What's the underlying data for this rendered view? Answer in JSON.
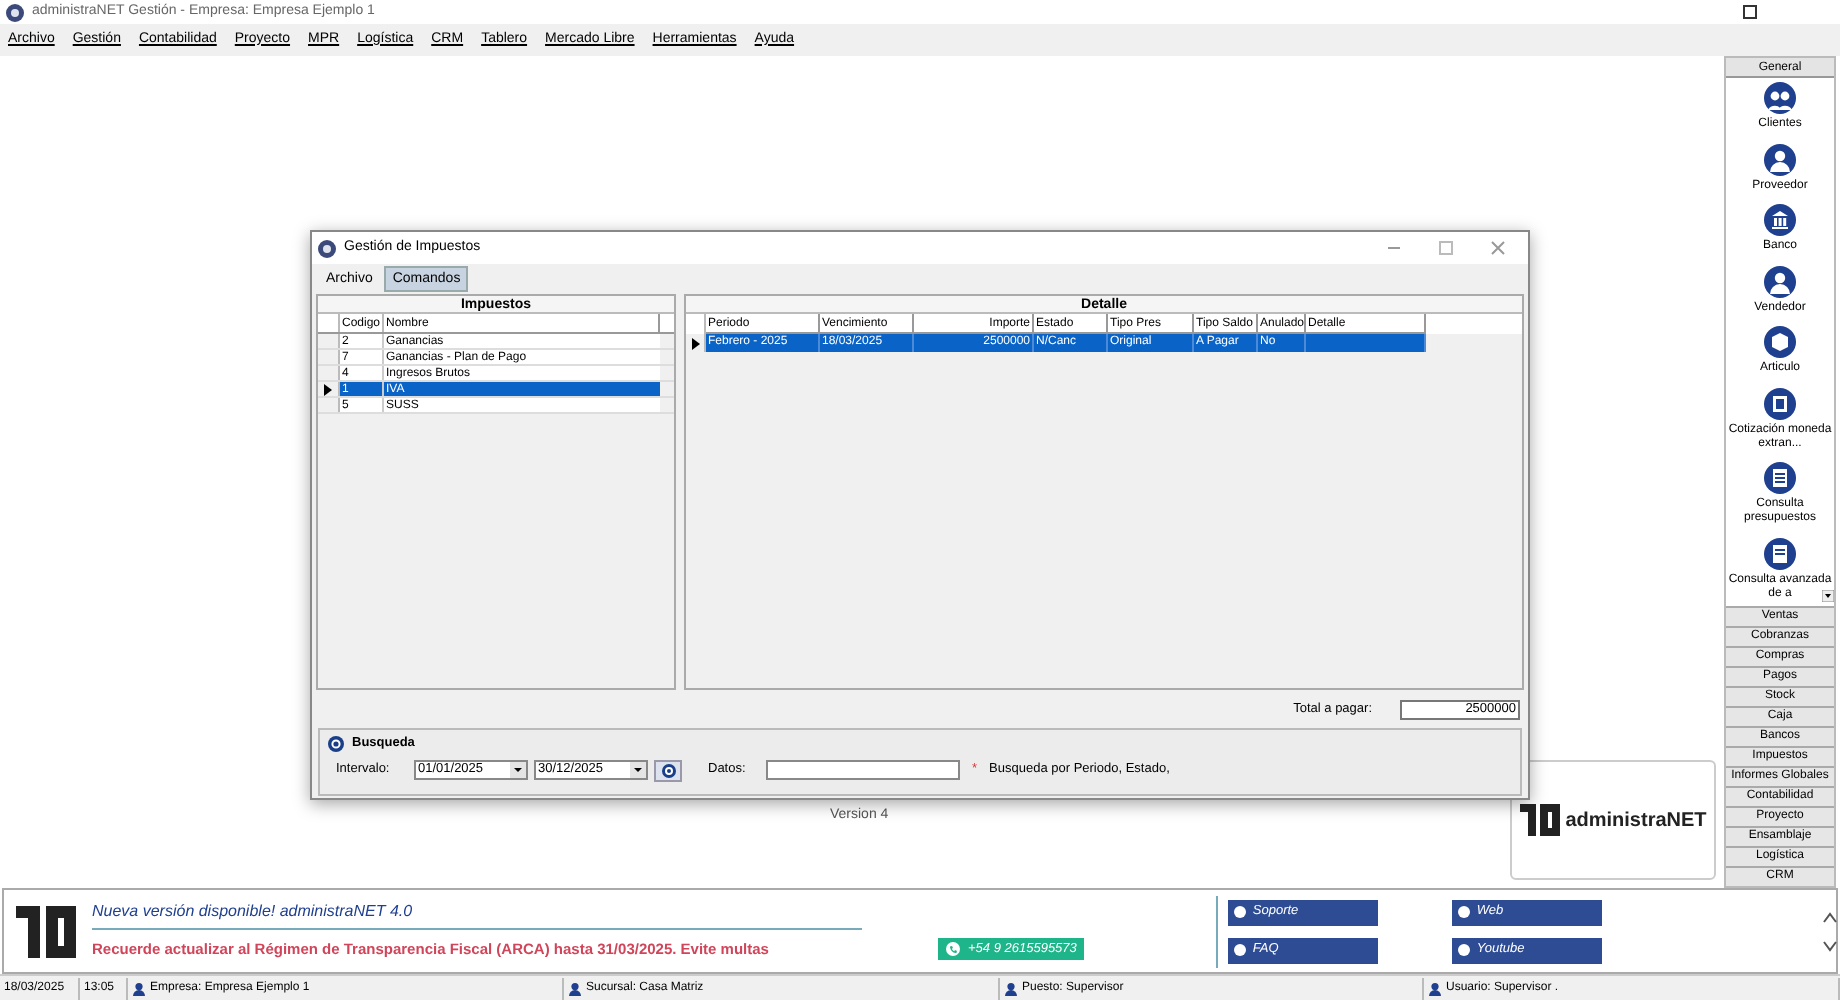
{
  "window": {
    "title": "administraNET Gestión - Empresa: Empresa Ejemplo 1"
  },
  "menu": [
    {
      "label": "Archivo"
    },
    {
      "label": "Gestión"
    },
    {
      "label": "Contabilidad"
    },
    {
      "label": "Proyecto"
    },
    {
      "label": "MPR"
    },
    {
      "label": "Logística"
    },
    {
      "label": "CRM"
    },
    {
      "label": "Tablero"
    },
    {
      "label": "Mercado Libre"
    },
    {
      "label": "Herramientas"
    },
    {
      "label": "Ayuda"
    }
  ],
  "dialog": {
    "title": "Gestión de Impuestos",
    "menu": [
      {
        "label": "Archivo",
        "selected": false
      },
      {
        "label": "Comandos",
        "selected": true
      }
    ],
    "taxes": {
      "title": "Impuestos",
      "columns": [
        "Codigo",
        "Nombre"
      ],
      "rows": [
        {
          "code": "2",
          "name": "Ganancias",
          "selected": false
        },
        {
          "code": "7",
          "name": "Ganancias - Plan de Pago",
          "selected": false
        },
        {
          "code": "4",
          "name": "Ingresos Brutos",
          "selected": false
        },
        {
          "code": "1",
          "name": "IVA",
          "selected": true
        },
        {
          "code": "5",
          "name": "SUSS",
          "selected": false
        }
      ]
    },
    "detail": {
      "title": "Detalle",
      "columns": [
        "Periodo",
        "Vencimiento",
        "Importe",
        "Estado",
        "Tipo Pres",
        "Tipo Saldo",
        "Anulado",
        "Detalle"
      ],
      "rows": [
        {
          "cells": [
            "Febrero - 2025",
            "18/03/2025",
            "2500000",
            "N/Canc",
            "Original",
            "A Pagar",
            "No",
            ""
          ],
          "selected": true
        }
      ]
    },
    "total_label": "Total a pagar:",
    "total_value": "2500000",
    "search": {
      "title": "Busqueda",
      "interval_label": "Intervalo:",
      "from": "01/01/2025",
      "to": "30/12/2025",
      "data_label": "Datos:",
      "asterisk": "*",
      "hint": "Busqueda por Periodo, Estado,"
    }
  },
  "version": "Version 4",
  "logo_text": "administraNET",
  "banner": {
    "headline": "Nueva versión disponible! administraNET 4.0",
    "notice": "Recuerde actualizar al Régimen de Transparencia Fiscal (ARCA) hasta 31/03/2025. Evite multas",
    "phone": "+54 9 2615595573",
    "links": [
      {
        "label": "Soporte"
      },
      {
        "label": "Web"
      },
      {
        "label": "FAQ"
      },
      {
        "label": "Youtube"
      }
    ]
  },
  "sidebar": {
    "header": "General",
    "items": [
      "Clientes",
      "Proveedor",
      "Banco",
      "Vendedor",
      "Articulo",
      "Cotización moneda extran...",
      "Consulta presupuestos",
      "Consulta avanzada de a"
    ],
    "sections": [
      "Ventas",
      "Cobranzas",
      "Compras",
      "Pagos",
      "Stock",
      "Caja",
      "Bancos",
      "Impuestos",
      "Informes Globales",
      "Contabilidad",
      "Proyecto",
      "Ensamblaje",
      "Logística",
      "CRM"
    ]
  },
  "status_bar": {
    "date": "18/03/2025",
    "time": "13:05",
    "company": "Empresa: Empresa Ejemplo 1",
    "branch": "Sucursal: Casa Matriz",
    "post": "Puesto: Supervisor",
    "user": "Usuario: Supervisor ."
  }
}
